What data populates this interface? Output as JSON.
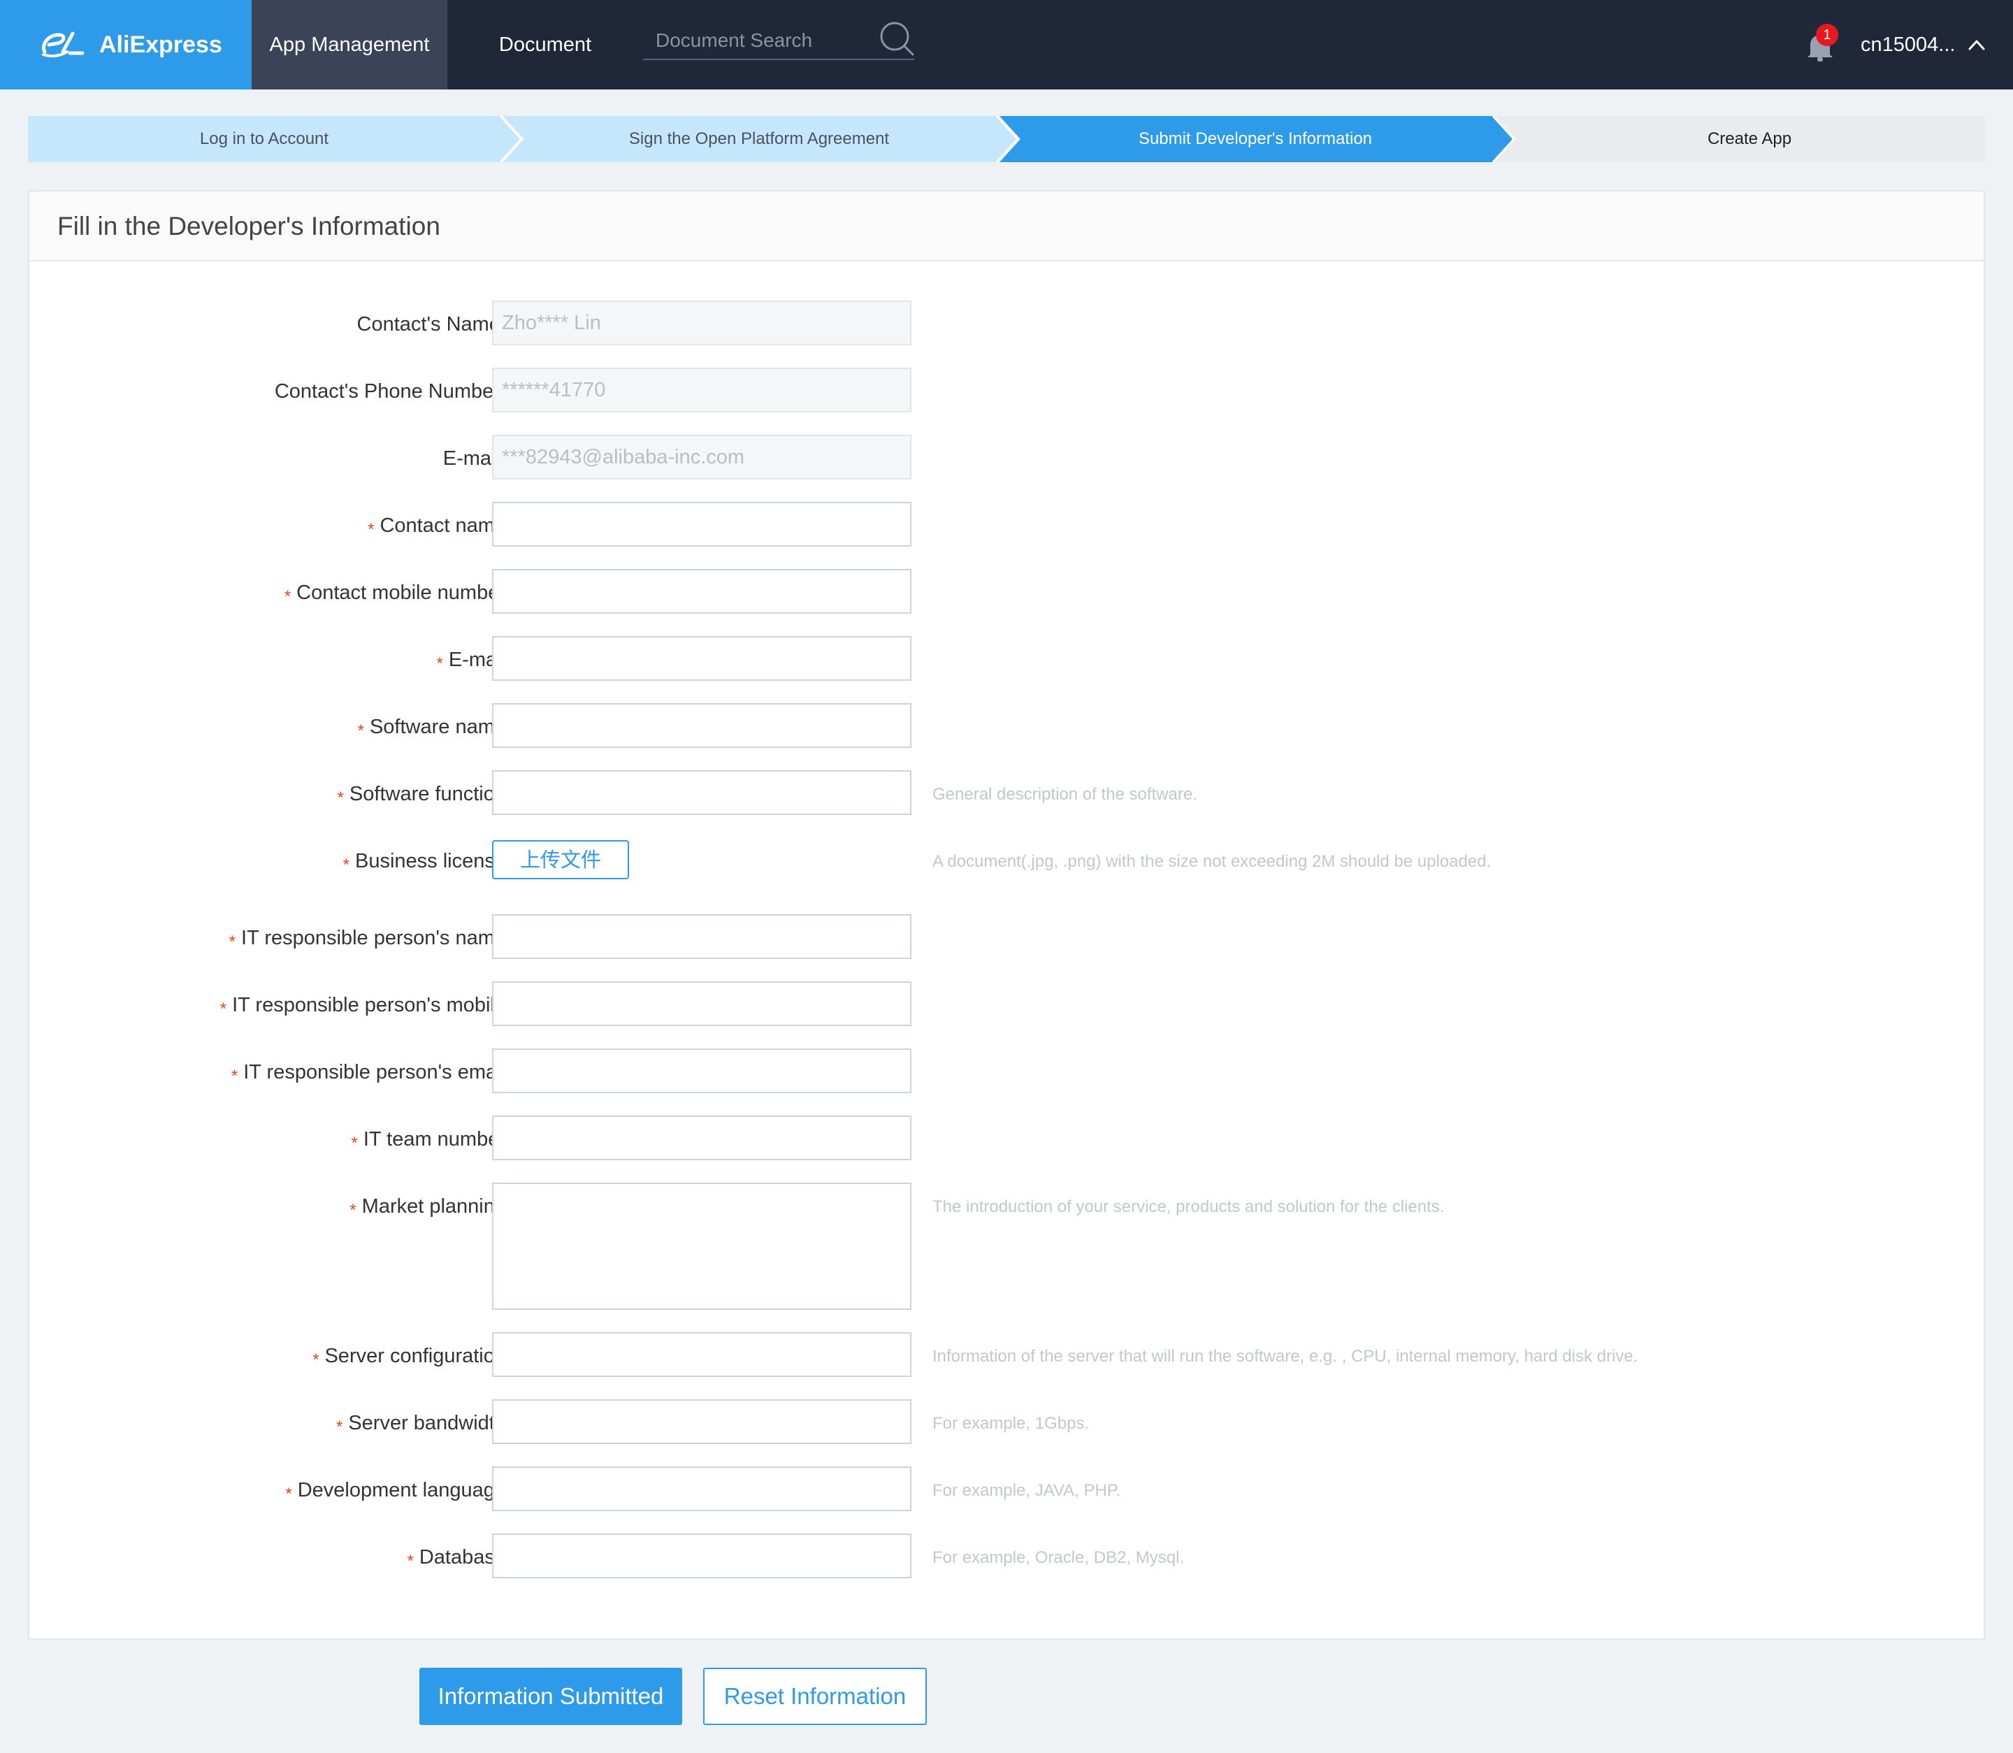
{
  "brand": {
    "name": "AliExpress"
  },
  "nav": {
    "app_management": "App Management",
    "document": "Document",
    "search_placeholder": "Document Search",
    "notification_count": "1",
    "user": "cn15004..."
  },
  "steps": [
    {
      "label": "Log in to Account",
      "state": "done"
    },
    {
      "label": "Sign the Open Platform Agreement",
      "state": "done"
    },
    {
      "label": "Submit Developer's Information",
      "state": "active"
    },
    {
      "label": "Create App",
      "state": "pending"
    }
  ],
  "colors": {
    "accent": "#2d9aea",
    "nav_bg": "#1f2738",
    "step_done": "#c5e6fb",
    "step_pending": "#e9ebee",
    "required": "#e8471c"
  },
  "form": {
    "title": "Fill in the Developer's Information",
    "fields": [
      {
        "label": "Contact's Name:",
        "required": false,
        "value": "Zho**** Lin",
        "disabled": true
      },
      {
        "label": "Contact's Phone Number:",
        "required": false,
        "value": "******41770",
        "disabled": true
      },
      {
        "label": "E-mail:",
        "required": false,
        "value": "***82943@alibaba-inc.com",
        "disabled": true
      },
      {
        "label": "Contact name",
        "required": true,
        "value": ""
      },
      {
        "label": "Contact mobile number",
        "required": true,
        "value": ""
      },
      {
        "label": "E-mail",
        "required": true,
        "value": ""
      },
      {
        "label": "Software name",
        "required": true,
        "value": ""
      },
      {
        "label": "Software function",
        "required": true,
        "value": "",
        "help": "General description of the software."
      },
      {
        "label": "Business license",
        "required": true,
        "button": "上传文件",
        "help": "A document(.jpg, .png) with the size not exceeding 2M should be uploaded."
      },
      {
        "label": "IT responsible person's name",
        "required": true,
        "value": ""
      },
      {
        "label": "IT responsible person's mobile",
        "required": true,
        "value": ""
      },
      {
        "label": "IT responsible person's email",
        "required": true,
        "value": ""
      },
      {
        "label": "IT team number",
        "required": true,
        "value": ""
      },
      {
        "label": "Market planning",
        "required": true,
        "value": "",
        "help": "The introduction of your service, products and solution for the clients."
      },
      {
        "label": "Server configuration",
        "required": true,
        "value": "",
        "help": "Information of the server that will run the software, e.g. , CPU, internal memory, hard disk drive."
      },
      {
        "label": "Server bandwidth",
        "required": true,
        "value": "",
        "help": "For example, 1Gbps."
      },
      {
        "label": "Development language",
        "required": true,
        "value": "",
        "help": "For example, JAVA, PHP."
      },
      {
        "label": "Database",
        "required": true,
        "value": "",
        "help": "For example, Oracle, DB2, Mysql."
      }
    ],
    "required_marker": "*",
    "submit_label": "Information Submitted",
    "reset_label": "Reset Information"
  }
}
